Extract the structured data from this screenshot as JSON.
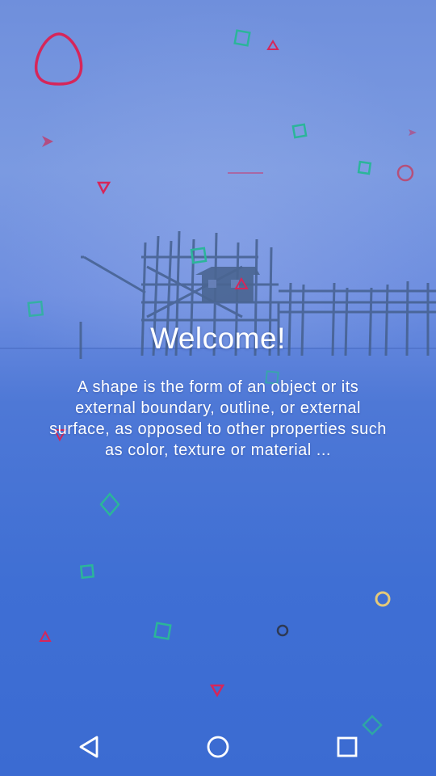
{
  "welcome": {
    "title": "Welcome!",
    "description": "A shape is the form of an object or its external boundary, outline, or external surface, as opposed to other properties such as color, texture or material ..."
  },
  "colors": {
    "accent_red": "#d6265a",
    "accent_green": "#2bb59a",
    "accent_yellow": "#e4c97a",
    "dark": "#2e3a55",
    "nav_icon": "#ffffff"
  },
  "navbar": {
    "back": "back-icon",
    "home": "home-icon",
    "recents": "recents-icon"
  }
}
